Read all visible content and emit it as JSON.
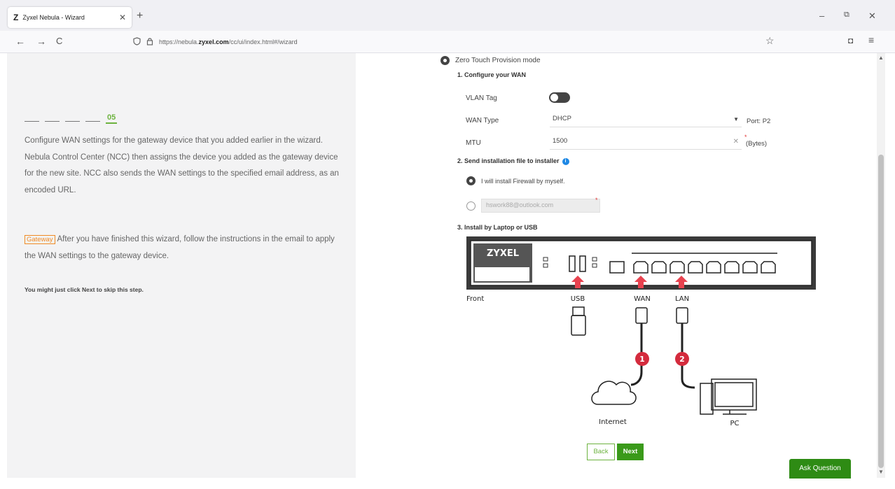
{
  "browser": {
    "tab_favicon": "Z",
    "tab_title": "Zyxel Nebula - Wizard",
    "tab_close": "✕",
    "new_tab": "+",
    "win_min": "–",
    "win_restore": "⧉",
    "win_close": "✕",
    "back": "←",
    "forward": "→",
    "reload": "C",
    "url_prefix": "https://nebula.",
    "url_domain": "zyxel.com",
    "url_suffix": "/cc/ui/index.html#/wizard",
    "star": "☆",
    "pocket": "◘",
    "menu": "≡"
  },
  "left": {
    "step_number": "05",
    "description": "Configure WAN settings for the gateway device that you added earlier in the wizard. Nebula Control Center (NCC) then assigns the device you added as the gateway device for the new site. NCC also sends the WAN settings to the specified email address, as an encoded URL.",
    "gateway_tag": "Gateway",
    "gateway_text": "After you have finished this wizard, follow the instructions in the email to apply the WAN settings to the gateway device.",
    "skip_hint": "You might just click Next to skip this step."
  },
  "form": {
    "ztp_label": "Zero Touch Provision mode",
    "section1": "1. Configure your WAN",
    "vlan_label": "VLAN Tag",
    "vlan_on": false,
    "wan_type_label": "WAN Type",
    "wan_type_value": "DHCP",
    "port_label": "Port: P2",
    "mtu_label": "MTU",
    "mtu_value": "1500",
    "mtu_clear": "✕",
    "bytes_label": "(Bytes)",
    "req_mark": "*",
    "section2": "2. Send installation file to installer",
    "info": "i",
    "opt_self": "I will install Firewall by myself.",
    "email_placeholder": "hswork88@outlook.com",
    "section3": "3. Install by Laptop or USB"
  },
  "diagram": {
    "brand": "ZYXEL",
    "front": "Front",
    "usb": "USB",
    "wan": "WAN",
    "lan": "LAN",
    "internet": "Internet",
    "pc": "PC",
    "badge1": "1",
    "badge2": "2"
  },
  "buttons": {
    "back": "Back",
    "next": "Next",
    "ask": "Ask Question"
  },
  "colors": {
    "accent_green": "#6db33f",
    "button_green": "#3a9a1a",
    "gateway_orange": "#f08a24",
    "arrow_red": "#e8424f",
    "info_blue": "#1e88e5"
  }
}
